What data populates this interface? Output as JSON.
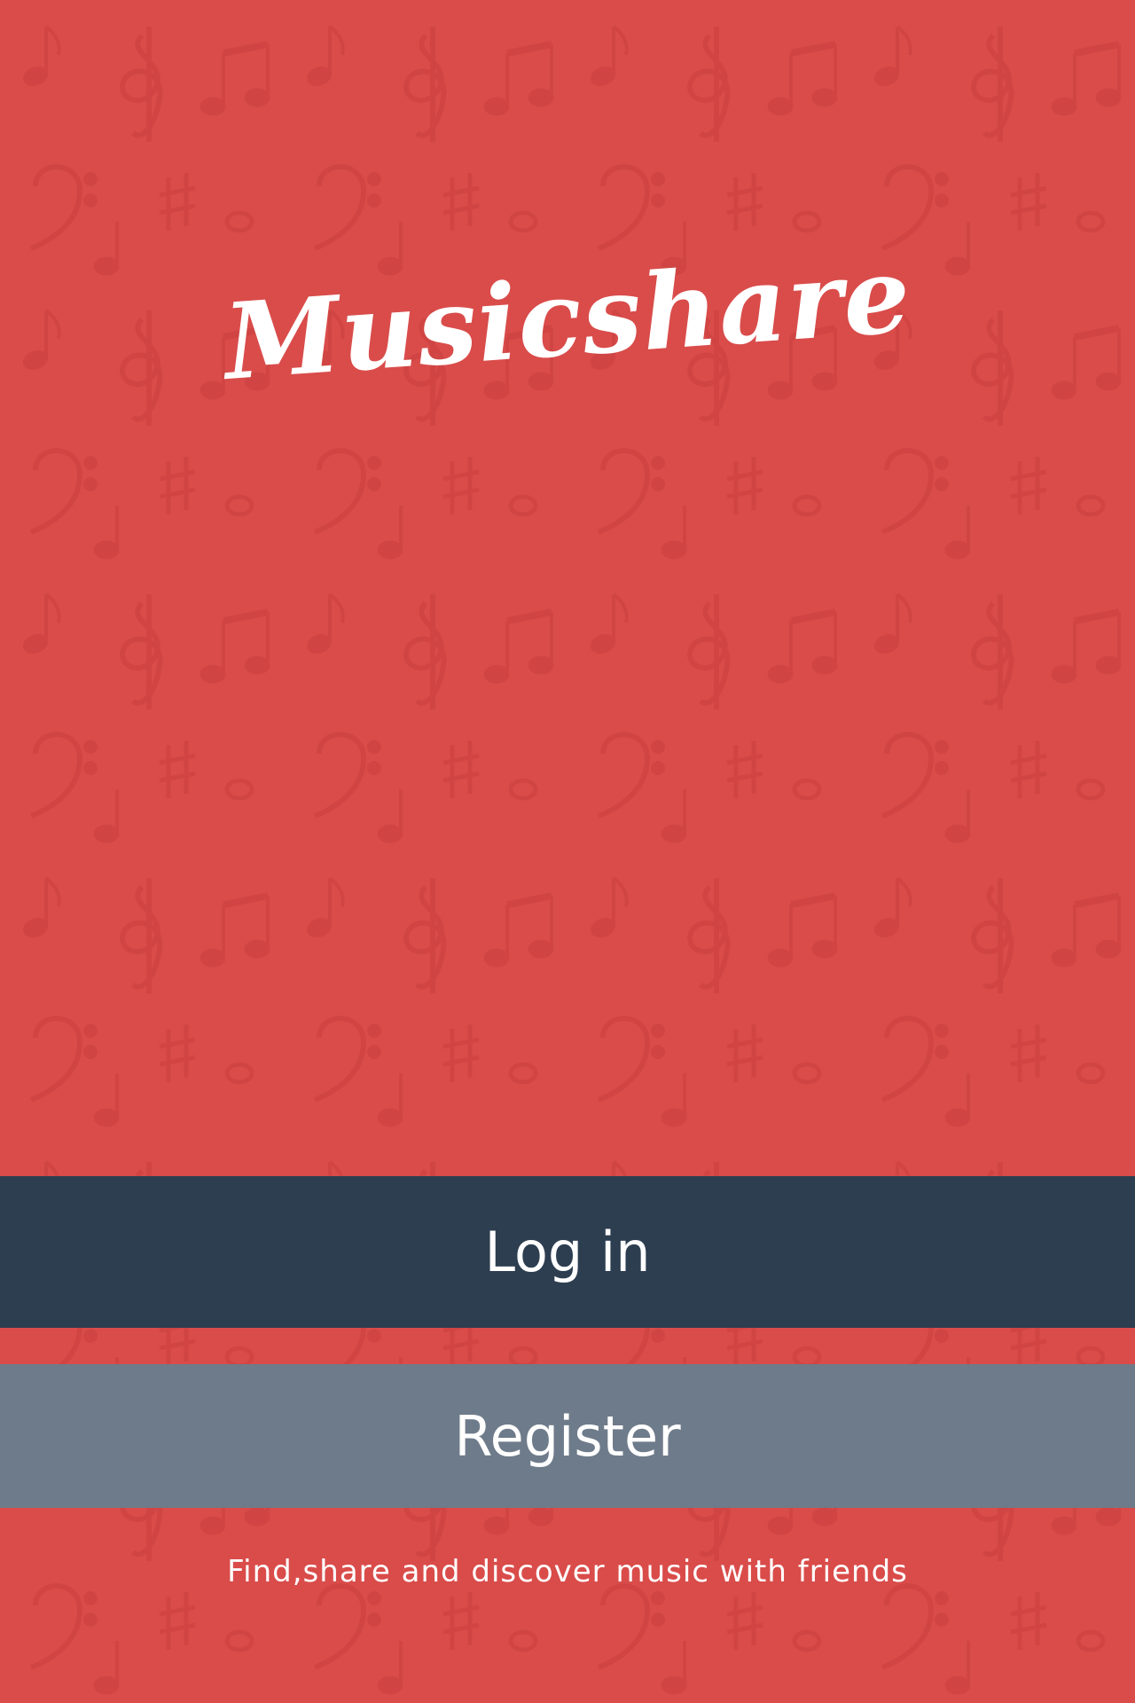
{
  "app": {
    "logo_text": "Musicshare",
    "tagline": "Find,share and discover music with friends"
  },
  "buttons": {
    "login_label": "Log in",
    "register_label": "Register"
  },
  "colors": {
    "background": "#d94c4a",
    "login_button": "#2d3e50",
    "register_button": "#6e7b8a",
    "text": "#ffffff"
  },
  "icons": {
    "background_pattern": "music-notes-pattern-icon"
  }
}
